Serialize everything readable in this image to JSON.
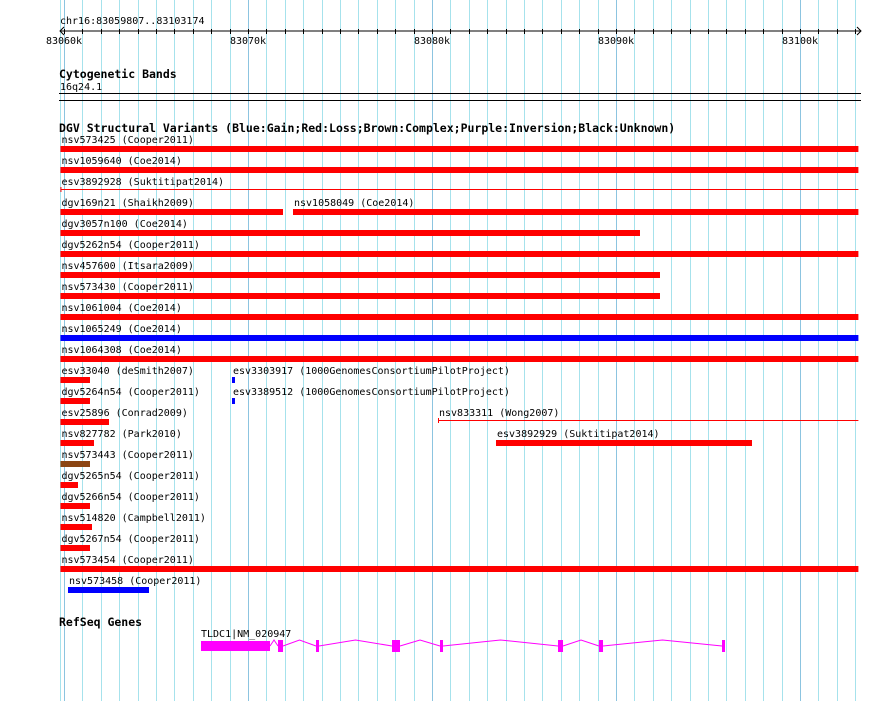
{
  "ruler": {
    "location": "chr16:83059807..83103174",
    "view_start": 83059807,
    "view_end": 83103174,
    "ticks": [
      "83060k",
      "83070k",
      "83080k",
      "83090k",
      "83100k"
    ],
    "tick_values": [
      83060000,
      83070000,
      83080000,
      83090000,
      83100000
    ]
  },
  "cytoband": {
    "title": "Cytogenetic Bands",
    "band": "16q24.1"
  },
  "dgv": {
    "title": "DGV Structural Variants (Blue:Gain;Red:Loss;Brown:Complex;Purple:Inversion;Black:Unknown)",
    "colors": {
      "gain": "#0000ff",
      "loss": "#ff0000",
      "complex": "#8b4513"
    },
    "features": [
      {
        "row": 0,
        "label": "nsv573425 (Cooper2011)",
        "type": "loss",
        "start": 83059807,
        "end": 83103174
      },
      {
        "row": 1,
        "label": "nsv1059640 (Coe2014)",
        "type": "loss",
        "start": 83059807,
        "end": 83103174
      },
      {
        "row": 2,
        "label": "esv3892928 (Suktitipat2014)",
        "type": "loss",
        "start": 83059807,
        "end": 83103174,
        "glyph": "line"
      },
      {
        "row": 3,
        "label": "dgv169n21 (Shaikh2009)",
        "type": "loss",
        "start": 83059807,
        "end": 83071902
      },
      {
        "row": 3,
        "label": "nsv1058049 (Coe2014)",
        "type": "loss",
        "start": 83072446,
        "end": 83103174
      },
      {
        "row": 4,
        "label": "dgv3057n100 (Coe2014)",
        "type": "loss",
        "start": 83059807,
        "end": 83091304
      },
      {
        "row": 5,
        "label": "dgv5262n54 (Cooper2011)",
        "type": "loss",
        "start": 83059807,
        "end": 83103174
      },
      {
        "row": 6,
        "label": "nsv457600 (Itsara2009)",
        "type": "loss",
        "start": 83059807,
        "end": 83092391
      },
      {
        "row": 7,
        "label": "nsv573430 (Cooper2011)",
        "type": "loss",
        "start": 83059807,
        "end": 83092391
      },
      {
        "row": 8,
        "label": "nsv1061004 (Coe2014)",
        "type": "loss",
        "start": 83059807,
        "end": 83103174
      },
      {
        "row": 9,
        "label": "nsv1065249 (Coe2014)",
        "type": "gain",
        "start": 83059807,
        "end": 83103174
      },
      {
        "row": 10,
        "label": "nsv1064308 (Coe2014)",
        "type": "loss",
        "start": 83059807,
        "end": 83103174
      },
      {
        "row": 11,
        "label": "esv33040 (deSmith2007)",
        "type": "loss",
        "start": 83059807,
        "end": 83061413
      },
      {
        "row": 11,
        "label": "esv3303917 (1000GenomesConsortiumPilotProject)",
        "type": "gain",
        "start": 83069130,
        "end": 83069293
      },
      {
        "row": 12,
        "label": "dgv5264n54 (Cooper2011)",
        "type": "loss",
        "start": 83059807,
        "end": 83061413
      },
      {
        "row": 12,
        "label": "esv3389512 (1000GenomesConsortiumPilotProject)",
        "type": "gain",
        "start": 83069130,
        "end": 83069293
      },
      {
        "row": 13,
        "label": "esv25896 (Conrad2009)",
        "type": "loss",
        "start": 83059807,
        "end": 83062446
      },
      {
        "row": 13,
        "label": "nsv833311 (Wong2007)",
        "type": "loss",
        "start": 83080326,
        "end": 83103174,
        "glyph": "line"
      },
      {
        "row": 14,
        "label": "nsv827782 (Park2010)",
        "type": "loss",
        "start": 83059807,
        "end": 83061630
      },
      {
        "row": 14,
        "label": "esv3892929 (Suktitipat2014)",
        "type": "loss",
        "start": 83083478,
        "end": 83097391
      },
      {
        "row": 15,
        "label": "nsv573443 (Cooper2011)",
        "type": "complex",
        "start": 83059807,
        "end": 83061413
      },
      {
        "row": 16,
        "label": "dgv5265n54 (Cooper2011)",
        "type": "loss",
        "start": 83059807,
        "end": 83060761
      },
      {
        "row": 17,
        "label": "dgv5266n54 (Cooper2011)",
        "type": "loss",
        "start": 83059807,
        "end": 83061413
      },
      {
        "row": 18,
        "label": "nsv514820 (Campbell2011)",
        "type": "loss",
        "start": 83059807,
        "end": 83061522
      },
      {
        "row": 19,
        "label": "dgv5267n54 (Cooper2011)",
        "type": "loss",
        "start": 83059807,
        "end": 83061413
      },
      {
        "row": 20,
        "label": "nsv573454 (Cooper2011)",
        "type": "loss",
        "start": 83059807,
        "end": 83103174
      },
      {
        "row": 21,
        "label": "nsv573458 (Cooper2011)",
        "type": "gain",
        "start": 83060217,
        "end": 83064620
      }
    ]
  },
  "refseq": {
    "title": "RefSeq Genes",
    "color": "#ff00ff",
    "gene": {
      "label": "TLDC1|NM_020947",
      "exons": [
        [
          83067446,
          83071196
        ],
        [
          83071631,
          83071902
        ],
        [
          83073696,
          83073859
        ],
        [
          83077826,
          83078261
        ],
        [
          83080435,
          83080598
        ],
        [
          83086848,
          83087120
        ],
        [
          83089076,
          83089294
        ],
        [
          83095761,
          83095924
        ]
      ]
    }
  }
}
